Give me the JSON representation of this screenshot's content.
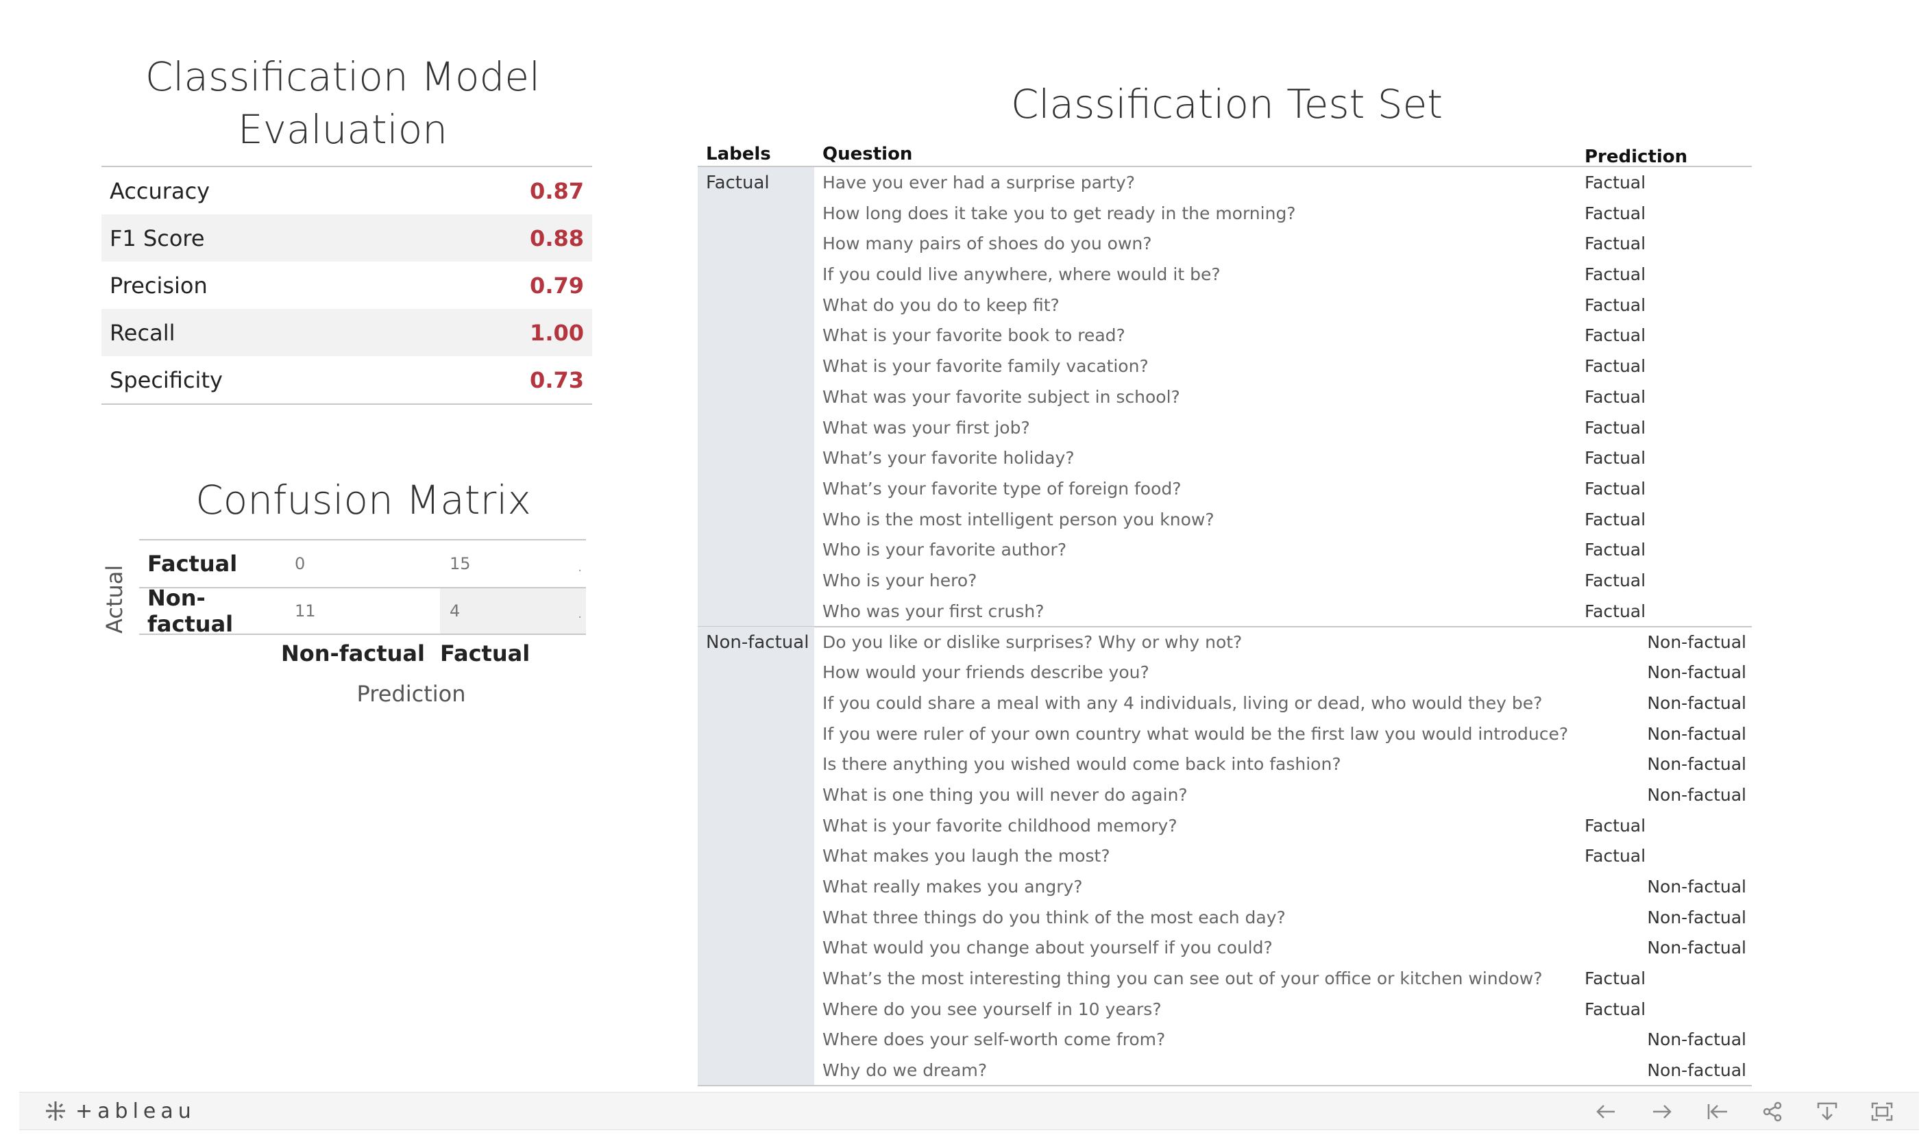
{
  "metrics": {
    "title": "Classification Model Evaluation",
    "rows": [
      {
        "label": "Accuracy",
        "value": "0.87"
      },
      {
        "label": "F1 Score",
        "value": "0.88"
      },
      {
        "label": "Precision",
        "value": "0.79"
      },
      {
        "label": "Recall",
        "value": "1.00"
      },
      {
        "label": "Specificity",
        "value": "0.73"
      }
    ],
    "value_color": "#b5353f"
  },
  "confusion_matrix": {
    "title": "Confusion Matrix",
    "row_axis_label": "Actual",
    "column_axis_label": "Prediction",
    "row_labels": [
      "Factual",
      "Non-factual"
    ],
    "column_labels": [
      "Non-factual",
      "Factual"
    ],
    "cells": [
      [
        "0",
        "15"
      ],
      [
        "11",
        "4"
      ]
    ]
  },
  "test_set": {
    "title": "Classification Test Set",
    "headers": {
      "labels": "Labels",
      "question": "Question",
      "prediction": "Prediction"
    },
    "groups": [
      {
        "label": "Factual",
        "rows": [
          {
            "question": "Have you ever had a surprise party?",
            "prediction": "Factual"
          },
          {
            "question": "How long does it take you to get ready in the morning?",
            "prediction": "Factual"
          },
          {
            "question": "How many pairs of shoes do you own?",
            "prediction": "Factual"
          },
          {
            "question": "If you could live anywhere, where would it be?",
            "prediction": "Factual"
          },
          {
            "question": "What do you do to keep fit?",
            "prediction": "Factual"
          },
          {
            "question": "What is your favorite book to read?",
            "prediction": "Factual"
          },
          {
            "question": "What is your favorite family vacation?",
            "prediction": "Factual"
          },
          {
            "question": "What was your favorite subject in school?",
            "prediction": "Factual"
          },
          {
            "question": "What was your first job?",
            "prediction": "Factual"
          },
          {
            "question": "What’s your favorite holiday?",
            "prediction": "Factual"
          },
          {
            "question": "What’s your favorite type of foreign food?",
            "prediction": "Factual"
          },
          {
            "question": "Who is the most intelligent person you know?",
            "prediction": "Factual"
          },
          {
            "question": "Who is your favorite author?",
            "prediction": "Factual"
          },
          {
            "question": "Who is your hero?",
            "prediction": "Factual"
          },
          {
            "question": "Who was your first crush?",
            "prediction": "Factual"
          }
        ]
      },
      {
        "label": "Non-factual",
        "rows": [
          {
            "question": "Do you like or dislike surprises? Why or why not?",
            "prediction": "Non-factual"
          },
          {
            "question": "How would your friends describe you?",
            "prediction": "Non-factual"
          },
          {
            "question": "If you could share a meal with any 4 individuals, living or dead, who would they be?",
            "prediction": "Non-factual"
          },
          {
            "question": "If you were ruler of your own country what would be the first law you would introduce?",
            "prediction": "Non-factual"
          },
          {
            "question": "Is there anything you wished would come back into fashion?",
            "prediction": "Non-factual"
          },
          {
            "question": "What is one thing you will never do again?",
            "prediction": "Non-factual"
          },
          {
            "question": "What is your favorite childhood memory?",
            "prediction": "Factual"
          },
          {
            "question": "What makes you laugh the most?",
            "prediction": "Factual"
          },
          {
            "question": "What really makes you angry?",
            "prediction": "Non-factual"
          },
          {
            "question": "What three things do you think of the most each day?",
            "prediction": "Non-factual"
          },
          {
            "question": "What would you change about yourself if you could?",
            "prediction": "Non-factual"
          },
          {
            "question": "What’s the most interesting thing you can see out of your office or kitchen window?",
            "prediction": "Factual"
          },
          {
            "question": "Where do you see yourself in 10 years?",
            "prediction": "Factual"
          },
          {
            "question": "Where does your self-worth come from?",
            "prediction": "Non-factual"
          },
          {
            "question": "Why do we dream?",
            "prediction": "Non-factual"
          }
        ]
      }
    ]
  },
  "toolbar": {
    "brand": "+ableau",
    "icons": [
      "undo-icon",
      "redo-icon",
      "revert-icon",
      "share-icon",
      "download-icon",
      "fullscreen-icon"
    ]
  }
}
